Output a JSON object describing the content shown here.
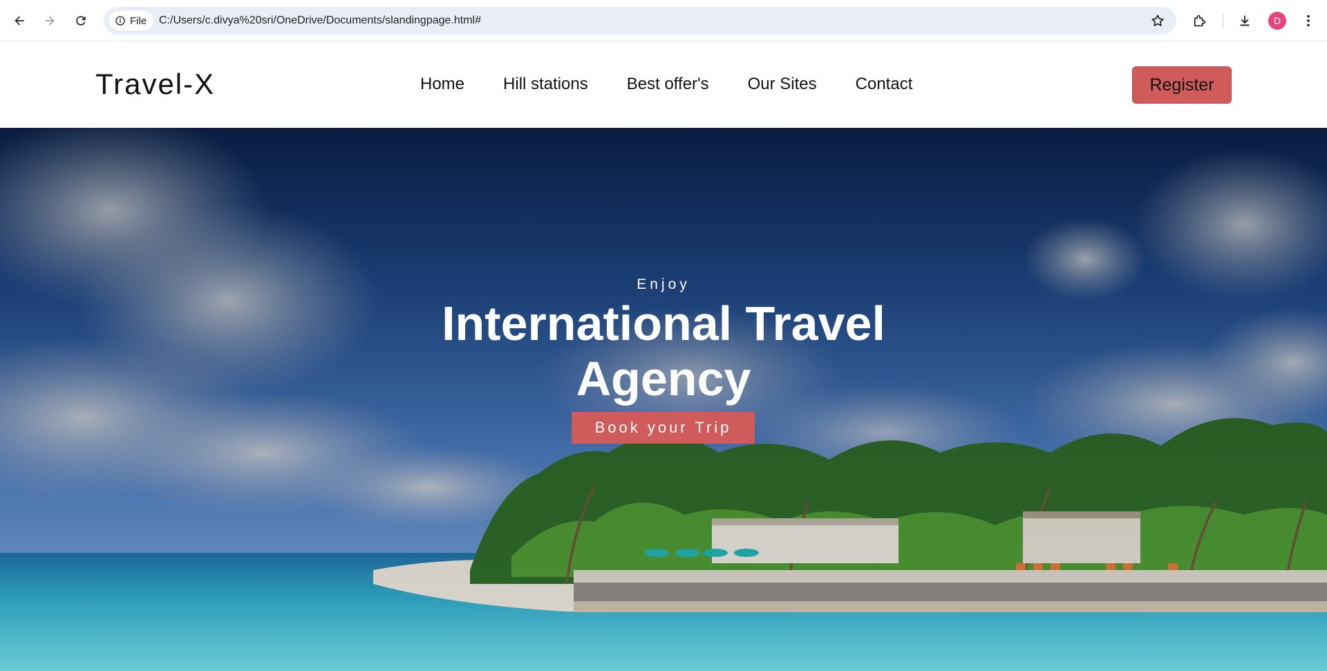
{
  "browser": {
    "site_info_label": "File",
    "url": "C:/Users/c.divya%20sri/OneDrive/Documents/slandingpage.html#",
    "profile_initial": "D",
    "profile_color": "#e8437b"
  },
  "site": {
    "logo": "Travel-X",
    "nav": [
      {
        "label": "Home"
      },
      {
        "label": "Hill stations"
      },
      {
        "label": "Best offer's"
      },
      {
        "label": "Our Sites"
      },
      {
        "label": "Contact"
      }
    ],
    "register_label": "Register",
    "accent_color": "#cf5b5b"
  },
  "hero": {
    "eyebrow": "Enjoy",
    "title_line1": "International Travel",
    "title_line2": "Agency",
    "cta_label": "Book your Trip"
  }
}
